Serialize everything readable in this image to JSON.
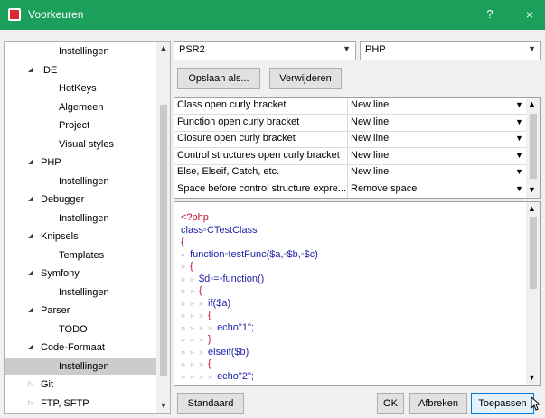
{
  "window": {
    "title": "Voorkeuren",
    "help_label": "?",
    "close_label": "×",
    "accent": "#1aa05a"
  },
  "tree": [
    {
      "label": "Instellingen",
      "level": 2,
      "arrow": ""
    },
    {
      "label": "IDE",
      "level": 1,
      "arrow": "expanded"
    },
    {
      "label": "HotKeys",
      "level": 2,
      "arrow": ""
    },
    {
      "label": "Algemeen",
      "level": 2,
      "arrow": ""
    },
    {
      "label": "Project",
      "level": 2,
      "arrow": ""
    },
    {
      "label": "Visual styles",
      "level": 2,
      "arrow": ""
    },
    {
      "label": "PHP",
      "level": 1,
      "arrow": "expanded"
    },
    {
      "label": "Instellingen",
      "level": 2,
      "arrow": ""
    },
    {
      "label": "Debugger",
      "level": 1,
      "arrow": "expanded"
    },
    {
      "label": "Instellingen",
      "level": 2,
      "arrow": ""
    },
    {
      "label": "Knipsels",
      "level": 1,
      "arrow": "expanded"
    },
    {
      "label": "Templates",
      "level": 2,
      "arrow": ""
    },
    {
      "label": "Symfony",
      "level": 1,
      "arrow": "expanded"
    },
    {
      "label": "Instellingen",
      "level": 2,
      "arrow": ""
    },
    {
      "label": "Parser",
      "level": 1,
      "arrow": "expanded"
    },
    {
      "label": "TODO",
      "level": 2,
      "arrow": ""
    },
    {
      "label": "Code-Formaat",
      "level": 1,
      "arrow": "expanded"
    },
    {
      "label": "Instellingen",
      "level": 2,
      "arrow": "",
      "selected": true
    },
    {
      "label": "Git",
      "level": 1,
      "arrow": "collapsed"
    },
    {
      "label": "FTP, SFTP",
      "level": 1,
      "arrow": "collapsed"
    }
  ],
  "style_select": {
    "value": "PSR2"
  },
  "language_select": {
    "value": "PHP"
  },
  "buttons": {
    "save_as": "Opslaan als...",
    "delete": "Verwijderen",
    "default": "Standaard",
    "ok": "OK",
    "cancel": "Afbreken",
    "apply": "Toepassen"
  },
  "grid_rows": [
    {
      "name": "Class open curly bracket",
      "value": "New line"
    },
    {
      "name": "Function open curly bracket",
      "value": "New line"
    },
    {
      "name": "Closure open curly bracket",
      "value": "New line"
    },
    {
      "name": "Control structures open curly bracket",
      "value": "New line"
    },
    {
      "name": "Else, Elseif, Catch, etc.",
      "value": "New line"
    },
    {
      "name": "Space before control structure expre...",
      "value": "Remove space"
    }
  ],
  "code_lines": [
    {
      "indent": 0,
      "text": "<?php",
      "red": true
    },
    {
      "indent": 0,
      "text": "class◦CTestClass"
    },
    {
      "indent": 0,
      "text": "{",
      "red": true
    },
    {
      "indent": 1,
      "text": "function◦testFunc($a,◦$b,◦$c)"
    },
    {
      "indent": 1,
      "text": "{",
      "red": true
    },
    {
      "indent": 2,
      "text": "$d◦=◦function()"
    },
    {
      "indent": 2,
      "text": "{",
      "red": true
    },
    {
      "indent": 3,
      "text": "if($a)"
    },
    {
      "indent": 3,
      "text": "{",
      "red": true
    },
    {
      "indent": 4,
      "text": "echo\"1\";"
    },
    {
      "indent": 3,
      "text": "}",
      "red": true
    },
    {
      "indent": 3,
      "text": "elseif($b)"
    },
    {
      "indent": 3,
      "text": "{",
      "red": true
    },
    {
      "indent": 4,
      "text": "echo\"2\";"
    }
  ],
  "icons": {
    "dropdown": "chevron-down-icon",
    "expanded": "triangle-expanded-icon",
    "collapsed": "triangle-collapsed-icon",
    "tab_mark": "»"
  }
}
